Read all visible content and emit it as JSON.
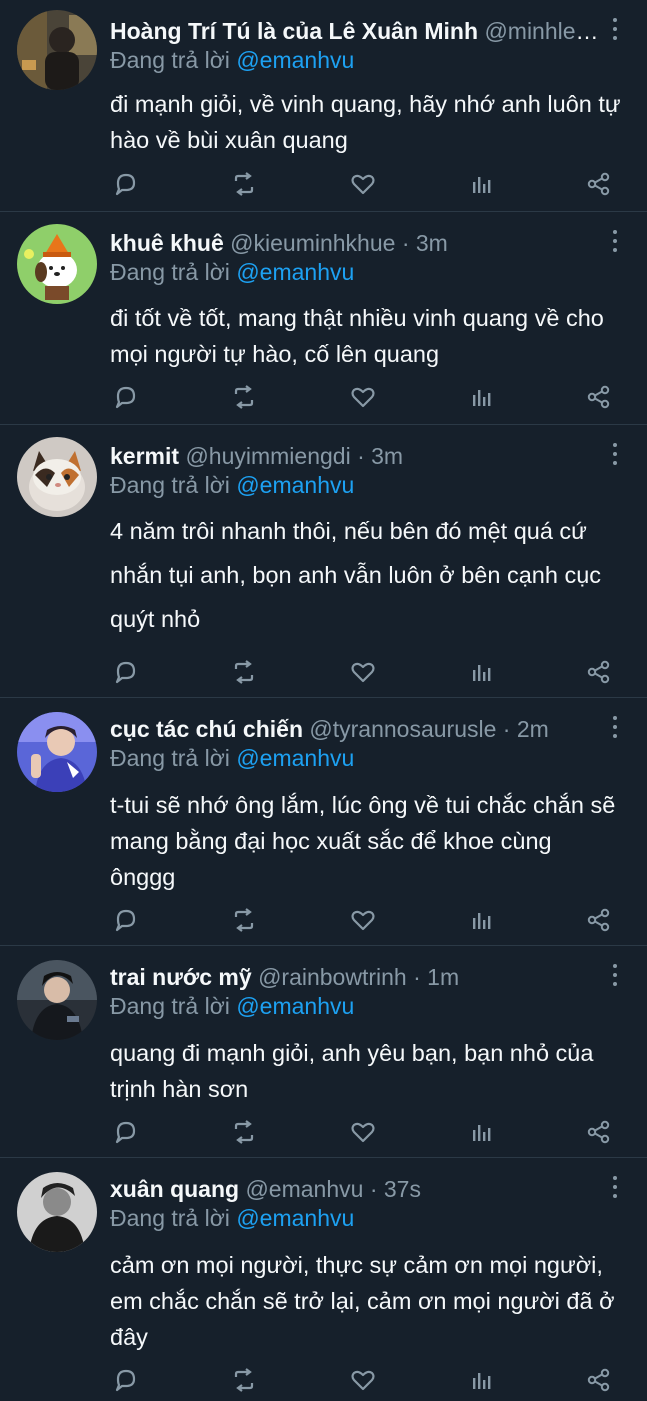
{
  "reply_prefix": "Đang trả lời",
  "tweets": [
    {
      "name": "Hoàng Trí Tú là của Lê Xuân Minh",
      "handle": "@minhlee...",
      "time": "",
      "reply_to": "@emanhvu",
      "text": "đi mạnh giỏi, về vinh quang, hãy nhớ anh luôn tự hào về bùi xuân quang",
      "avatar": "avatar-photo-1"
    },
    {
      "name": "khuê khuê",
      "handle": "@kieuminhkhue",
      "time": "3m",
      "reply_to": "@emanhvu",
      "text": "đi tốt về tốt, mang thật nhiều vinh quang về cho mọi người tự hào, cố lên quang",
      "avatar": "avatar-cartoon-dog"
    },
    {
      "name": "kermit",
      "handle": "@huyimmiengdi",
      "time": "3m",
      "reply_to": "@emanhvu",
      "text": "4 năm trôi nhanh thôi, nếu bên đó mệt quá cứ nhắn tụi anh, bọn anh vẫn luôn ở bên cạnh cục quýt nhỏ",
      "avatar": "avatar-cat"
    },
    {
      "name": "cục tác chú chiến",
      "handle": "@tyrannosaurusle",
      "time": "2m",
      "reply_to": "@emanhvu",
      "text": "t-tui sẽ nhớ ông lắm, lúc ông về tui chắc chắn sẽ mang bằng đại học xuất sắc để khoe cùng ônggg",
      "avatar": "avatar-blue-person"
    },
    {
      "name": "trai nước mỹ",
      "handle": "@rainbowtrinh",
      "time": "1m",
      "reply_to": "@emanhvu",
      "text": "quang đi mạnh giỏi, anh yêu bạn, bạn nhỏ của trịnh hàn sơn",
      "avatar": "avatar-dark-person"
    },
    {
      "name": "xuân quang",
      "handle": "@emanhvu",
      "time": "37s",
      "reply_to": "@emanhvu",
      "text": "cảm ơn mọi người, thực sự cảm ơn mọi người, em chắc chắn sẽ trở lại, cảm ơn mọi người đã ở đây",
      "avatar": "avatar-bw-person"
    }
  ],
  "colors": {
    "background": "#16202b",
    "text": "#f5f8fa",
    "muted": "#8899a6",
    "mention": "#1da1f2",
    "divider": "#2b3946"
  },
  "icons": [
    "reply-icon",
    "retweet-icon",
    "like-icon",
    "stats-icon",
    "share-icon",
    "more-icon"
  ]
}
